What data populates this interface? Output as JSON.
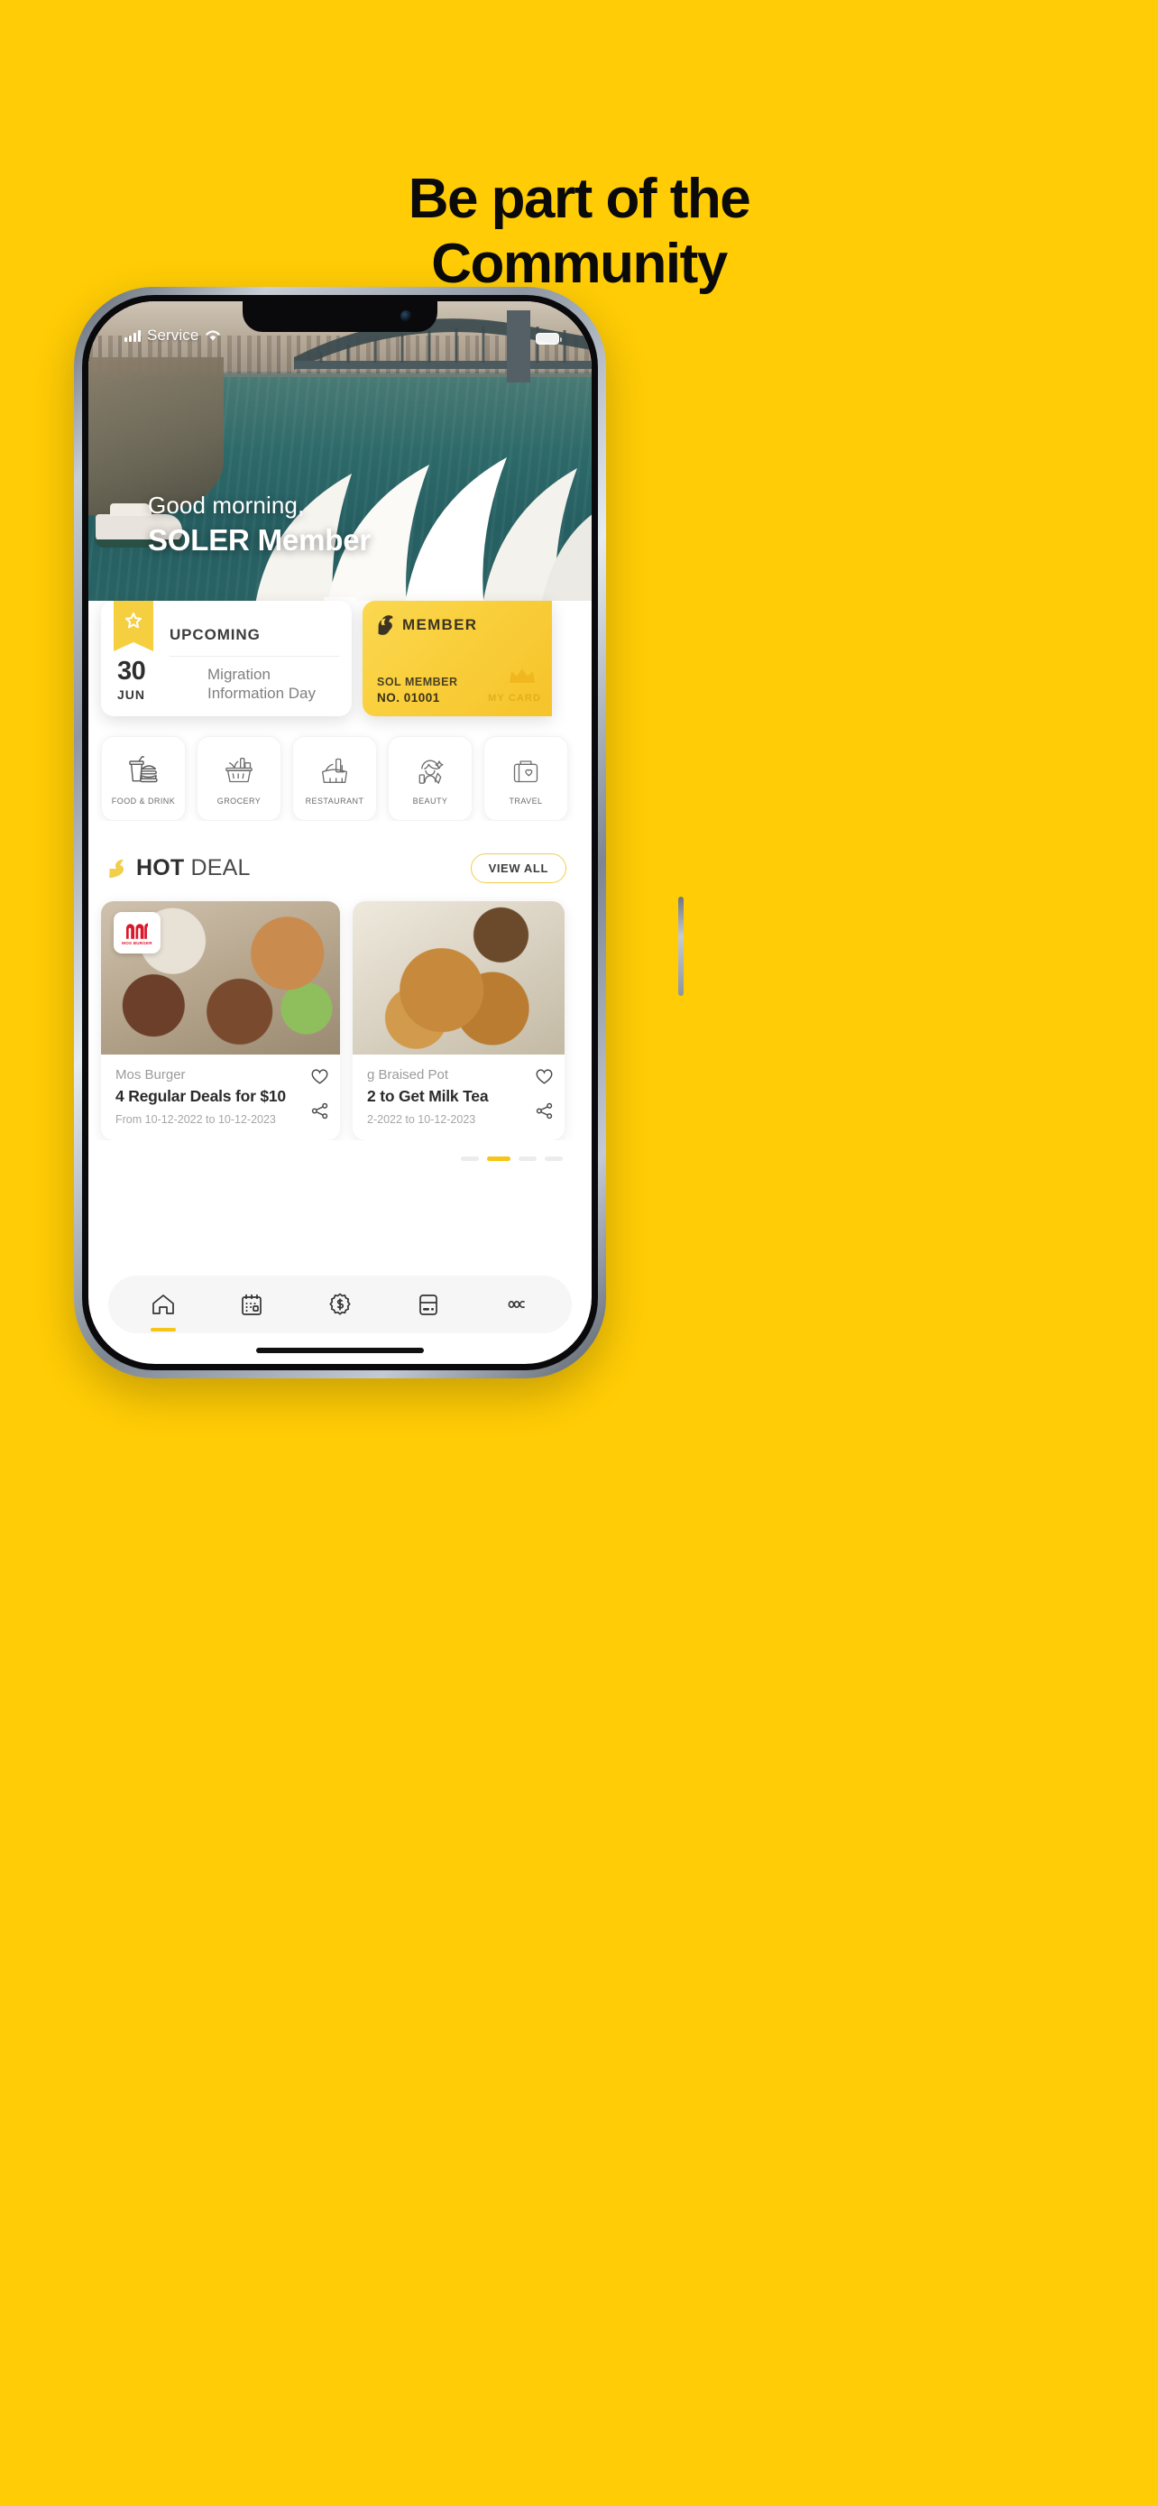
{
  "poster": {
    "background_color": "#FFCC05",
    "headline_line1": "Be part of the",
    "headline_line2": "Community"
  },
  "phone": {
    "status_bar": {
      "carrier": "Service",
      "signal_icon": "signal-bars-icon",
      "wifi_icon": "wifi-icon",
      "battery_icon": "battery-icon"
    },
    "hero": {
      "greeting_small": "Good morning,",
      "greeting_name": "SOLER Member",
      "image_alt": "sydney-harbour-opera-house-photo"
    },
    "upcoming_card": {
      "badge_icon": "star-bookmark-icon",
      "title": "UPCOMING",
      "day": "30",
      "month": "JUN",
      "event_line1": "Migration",
      "event_line2": "Information Day"
    },
    "member_card": {
      "logo_icon": "sol-s-logo-icon",
      "label": "MEMBER",
      "member_type": "SOL MEMBER",
      "member_no": "NO. 01001",
      "crown_icon": "crown-icon",
      "my_card_label": "MY CARD",
      "accent_color": "#F9CE3A"
    },
    "categories": [
      {
        "label": "FOOD & DRINK",
        "icon": "burger-drink-icon",
        "active": true
      },
      {
        "label": "GROCERY",
        "icon": "grocery-basket-icon",
        "active": false
      },
      {
        "label": "RESTAURANT",
        "icon": "dining-table-icon",
        "active": false
      },
      {
        "label": "BEAUTY",
        "icon": "beauty-makeup-icon",
        "active": false
      },
      {
        "label": "TRAVEL",
        "icon": "suitcase-travel-icon",
        "active": false
      }
    ],
    "hot_deal": {
      "logo_icon": "sol-s-logo-icon",
      "title_bold": "HOT",
      "title_light": "DEAL",
      "view_all_label": "VIEW ALL",
      "accent_color": "#F5C518"
    },
    "deals": [
      {
        "merchant": "Mos Burger",
        "name": "4 Regular Deals for $10",
        "dates": "From 10-12-2022 to 10-12-2023",
        "brand_logo": "mos-burger-logo",
        "brand_logo_text": "MOS BURGER",
        "image": "burgers-and-drinks-photo",
        "like_icon": "heart-icon",
        "share_icon": "share-icon"
      },
      {
        "merchant": "g Braised Pot",
        "name": "2 to Get Milk Tea",
        "dates": "2-2022 to 10-12-2023",
        "image": "fried-chicken-photo",
        "like_icon": "heart-icon",
        "share_icon": "share-icon"
      }
    ],
    "pagination": {
      "count": 4,
      "active_index": 1
    },
    "bottom_nav": [
      {
        "icon": "home-icon",
        "active": true
      },
      {
        "icon": "calendar-icon",
        "active": false
      },
      {
        "icon": "dollar-badge-icon",
        "active": false
      },
      {
        "icon": "card-icon",
        "active": false
      },
      {
        "icon": "more-dots-icon",
        "active": false
      }
    ]
  }
}
